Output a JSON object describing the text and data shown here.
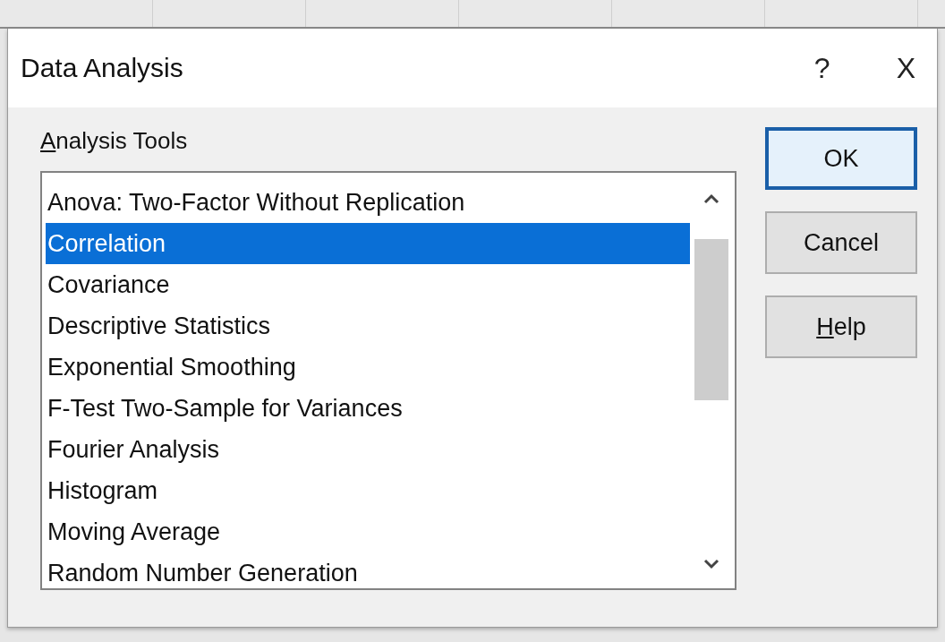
{
  "window": {
    "title": "Data Analysis",
    "help_glyph": "?",
    "close_glyph": "X"
  },
  "list_label": {
    "text": "Analysis Tools",
    "mnemonic_first": true
  },
  "tools": [
    {
      "label": "Anova: Two-Factor Without Replication",
      "selected": false
    },
    {
      "label": "Correlation",
      "selected": true
    },
    {
      "label": "Covariance",
      "selected": false
    },
    {
      "label": "Descriptive Statistics",
      "selected": false
    },
    {
      "label": "Exponential Smoothing",
      "selected": false
    },
    {
      "label": "F-Test Two-Sample for Variances",
      "selected": false
    },
    {
      "label": "Fourier Analysis",
      "selected": false
    },
    {
      "label": "Histogram",
      "selected": false
    },
    {
      "label": "Moving Average",
      "selected": false
    },
    {
      "label": "Random Number Generation",
      "selected": false
    }
  ],
  "buttons": [
    {
      "label": "OK",
      "default": true,
      "mnemonic_first": false
    },
    {
      "label": "Cancel",
      "default": false,
      "mnemonic_first": false
    },
    {
      "label": "Help",
      "default": false,
      "mnemonic_first": true
    }
  ]
}
